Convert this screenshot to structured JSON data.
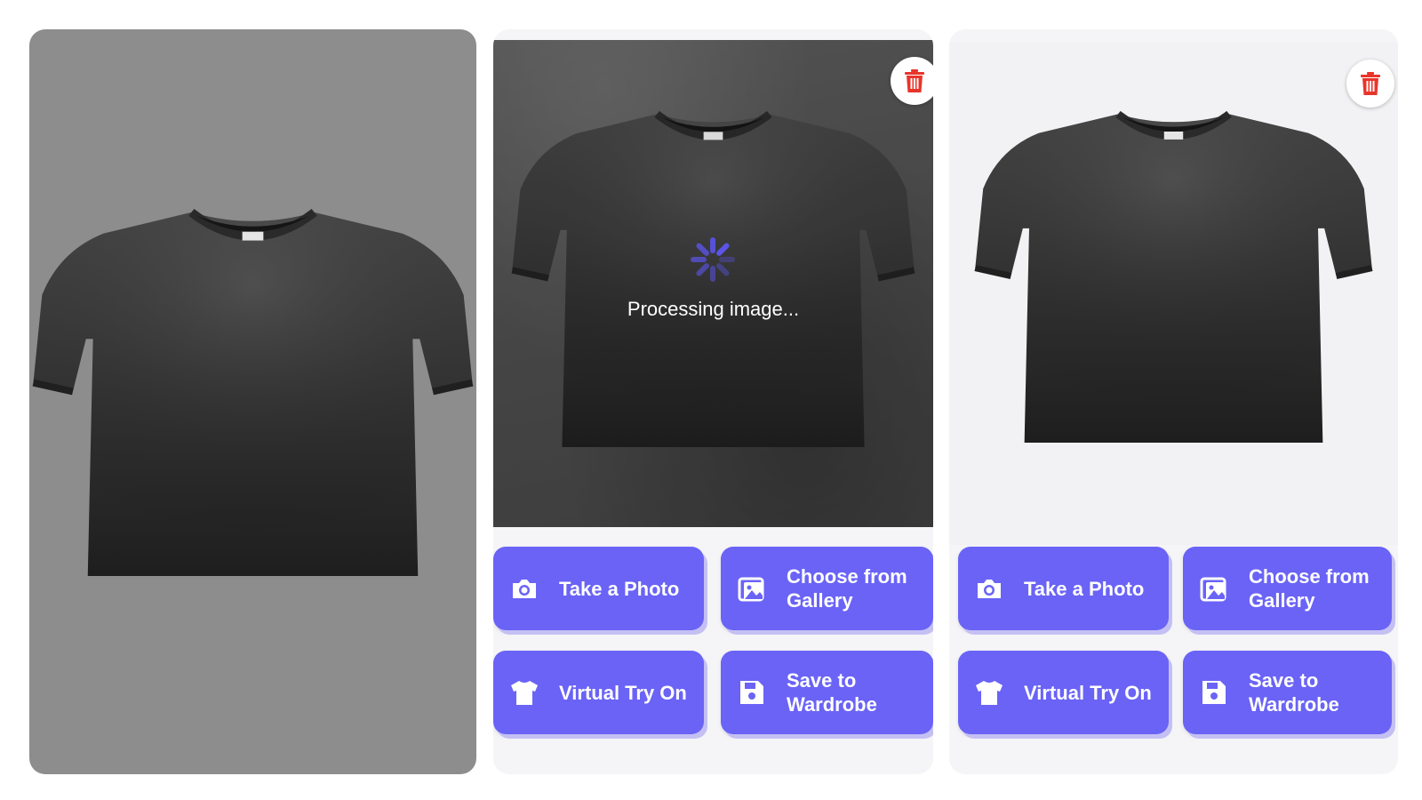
{
  "colors": {
    "accent": "#6a63f6",
    "accent_shadow": "#c4c0f3",
    "delete": "#e8352b",
    "spinner": "#5b54e6"
  },
  "panel_processing": {
    "status_text": "Processing image...",
    "delete_icon": "trash-icon"
  },
  "panel_result": {
    "delete_icon": "trash-icon"
  },
  "buttons": {
    "take_photo": {
      "label": "Take a Photo",
      "icon": "camera-icon"
    },
    "choose_gallery": {
      "label": "Choose from\nGallery",
      "icon": "gallery-icon"
    },
    "virtual_try_on": {
      "label": "Virtual Try On",
      "icon": "tshirt-icon"
    },
    "save_wardrobe": {
      "label": "Save to\nWardrobe",
      "icon": "save-icon"
    }
  }
}
